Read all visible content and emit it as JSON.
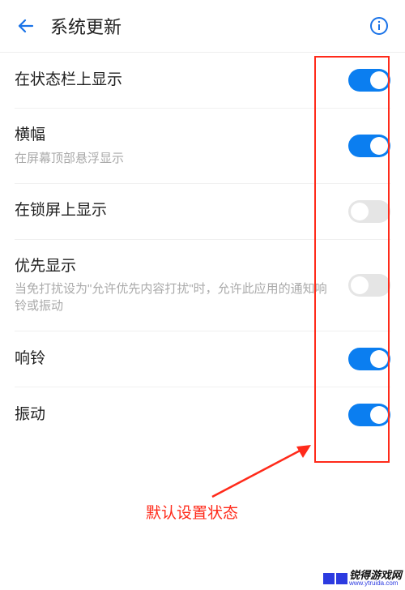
{
  "header": {
    "title": "系统更新"
  },
  "rows": [
    {
      "title": "在状态栏上显示",
      "sub": "",
      "on": true
    },
    {
      "title": "横幅",
      "sub": "在屏幕顶部悬浮显示",
      "on": true
    },
    {
      "title": "在锁屏上显示",
      "sub": "",
      "on": false
    },
    {
      "title": "优先显示",
      "sub": "当免打扰设为\"允许优先内容打扰\"时，允许此应用的通知响铃或振动",
      "on": false
    },
    {
      "title": "响铃",
      "sub": "",
      "on": true
    },
    {
      "title": "振动",
      "sub": "",
      "on": true
    }
  ],
  "annotation": {
    "text": "默认设置状态"
  },
  "watermark": {
    "cn": "锐得游戏网",
    "url": "www.ytruida.com"
  }
}
